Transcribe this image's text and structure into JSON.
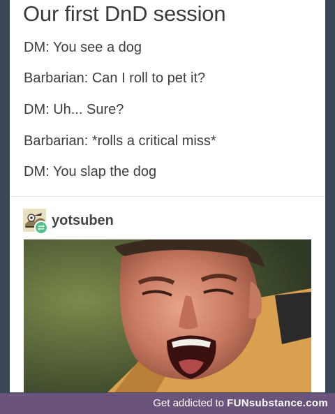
{
  "post": {
    "title": "Our first DnD session",
    "lines": [
      "DM: You see a dog",
      "Barbarian: Can I roll to pet it?",
      "DM: Uh... Sure?",
      "Barbarian: *rolls a critical miss*",
      "DM: You slap the dog"
    ]
  },
  "reblog": {
    "username": "yotsuben",
    "avatar_icon": "cartoon-avatar-icon",
    "badge_icon": "reblog-icon",
    "badge_color": "#56bc8a"
  },
  "image": {
    "description_icon": "screaming-man-photo"
  },
  "footer": {
    "prefix": "Get addicted to",
    "brand": "FUNsubstance.com",
    "background": "#6b547c"
  }
}
